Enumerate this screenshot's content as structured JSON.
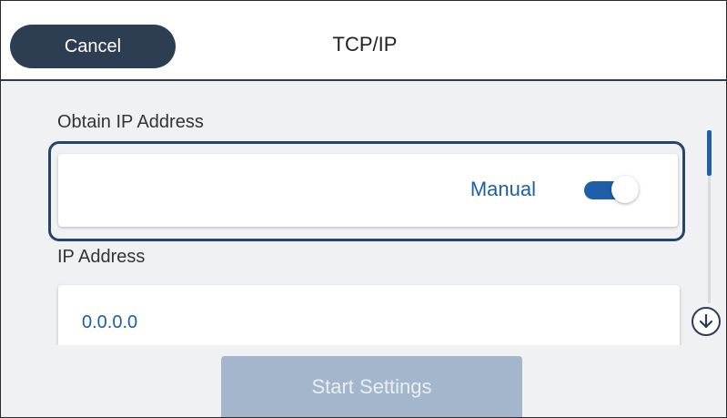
{
  "header": {
    "cancel_label": "Cancel",
    "title": "TCP/IP"
  },
  "obtain_ip": {
    "label": "Obtain IP Address",
    "value": "Manual",
    "toggle_on": true
  },
  "ip_address": {
    "label": "IP Address",
    "value": "0.0.0.0"
  },
  "scroll": {
    "down_icon": "arrow-down-circle-icon"
  },
  "footer": {
    "start_label": "Start Settings"
  },
  "colors": {
    "header_dark": "#2d3d52",
    "accent_blue": "#1f5ea8",
    "disabled_button": "#a3b6cc",
    "background": "#f0f1f3"
  }
}
